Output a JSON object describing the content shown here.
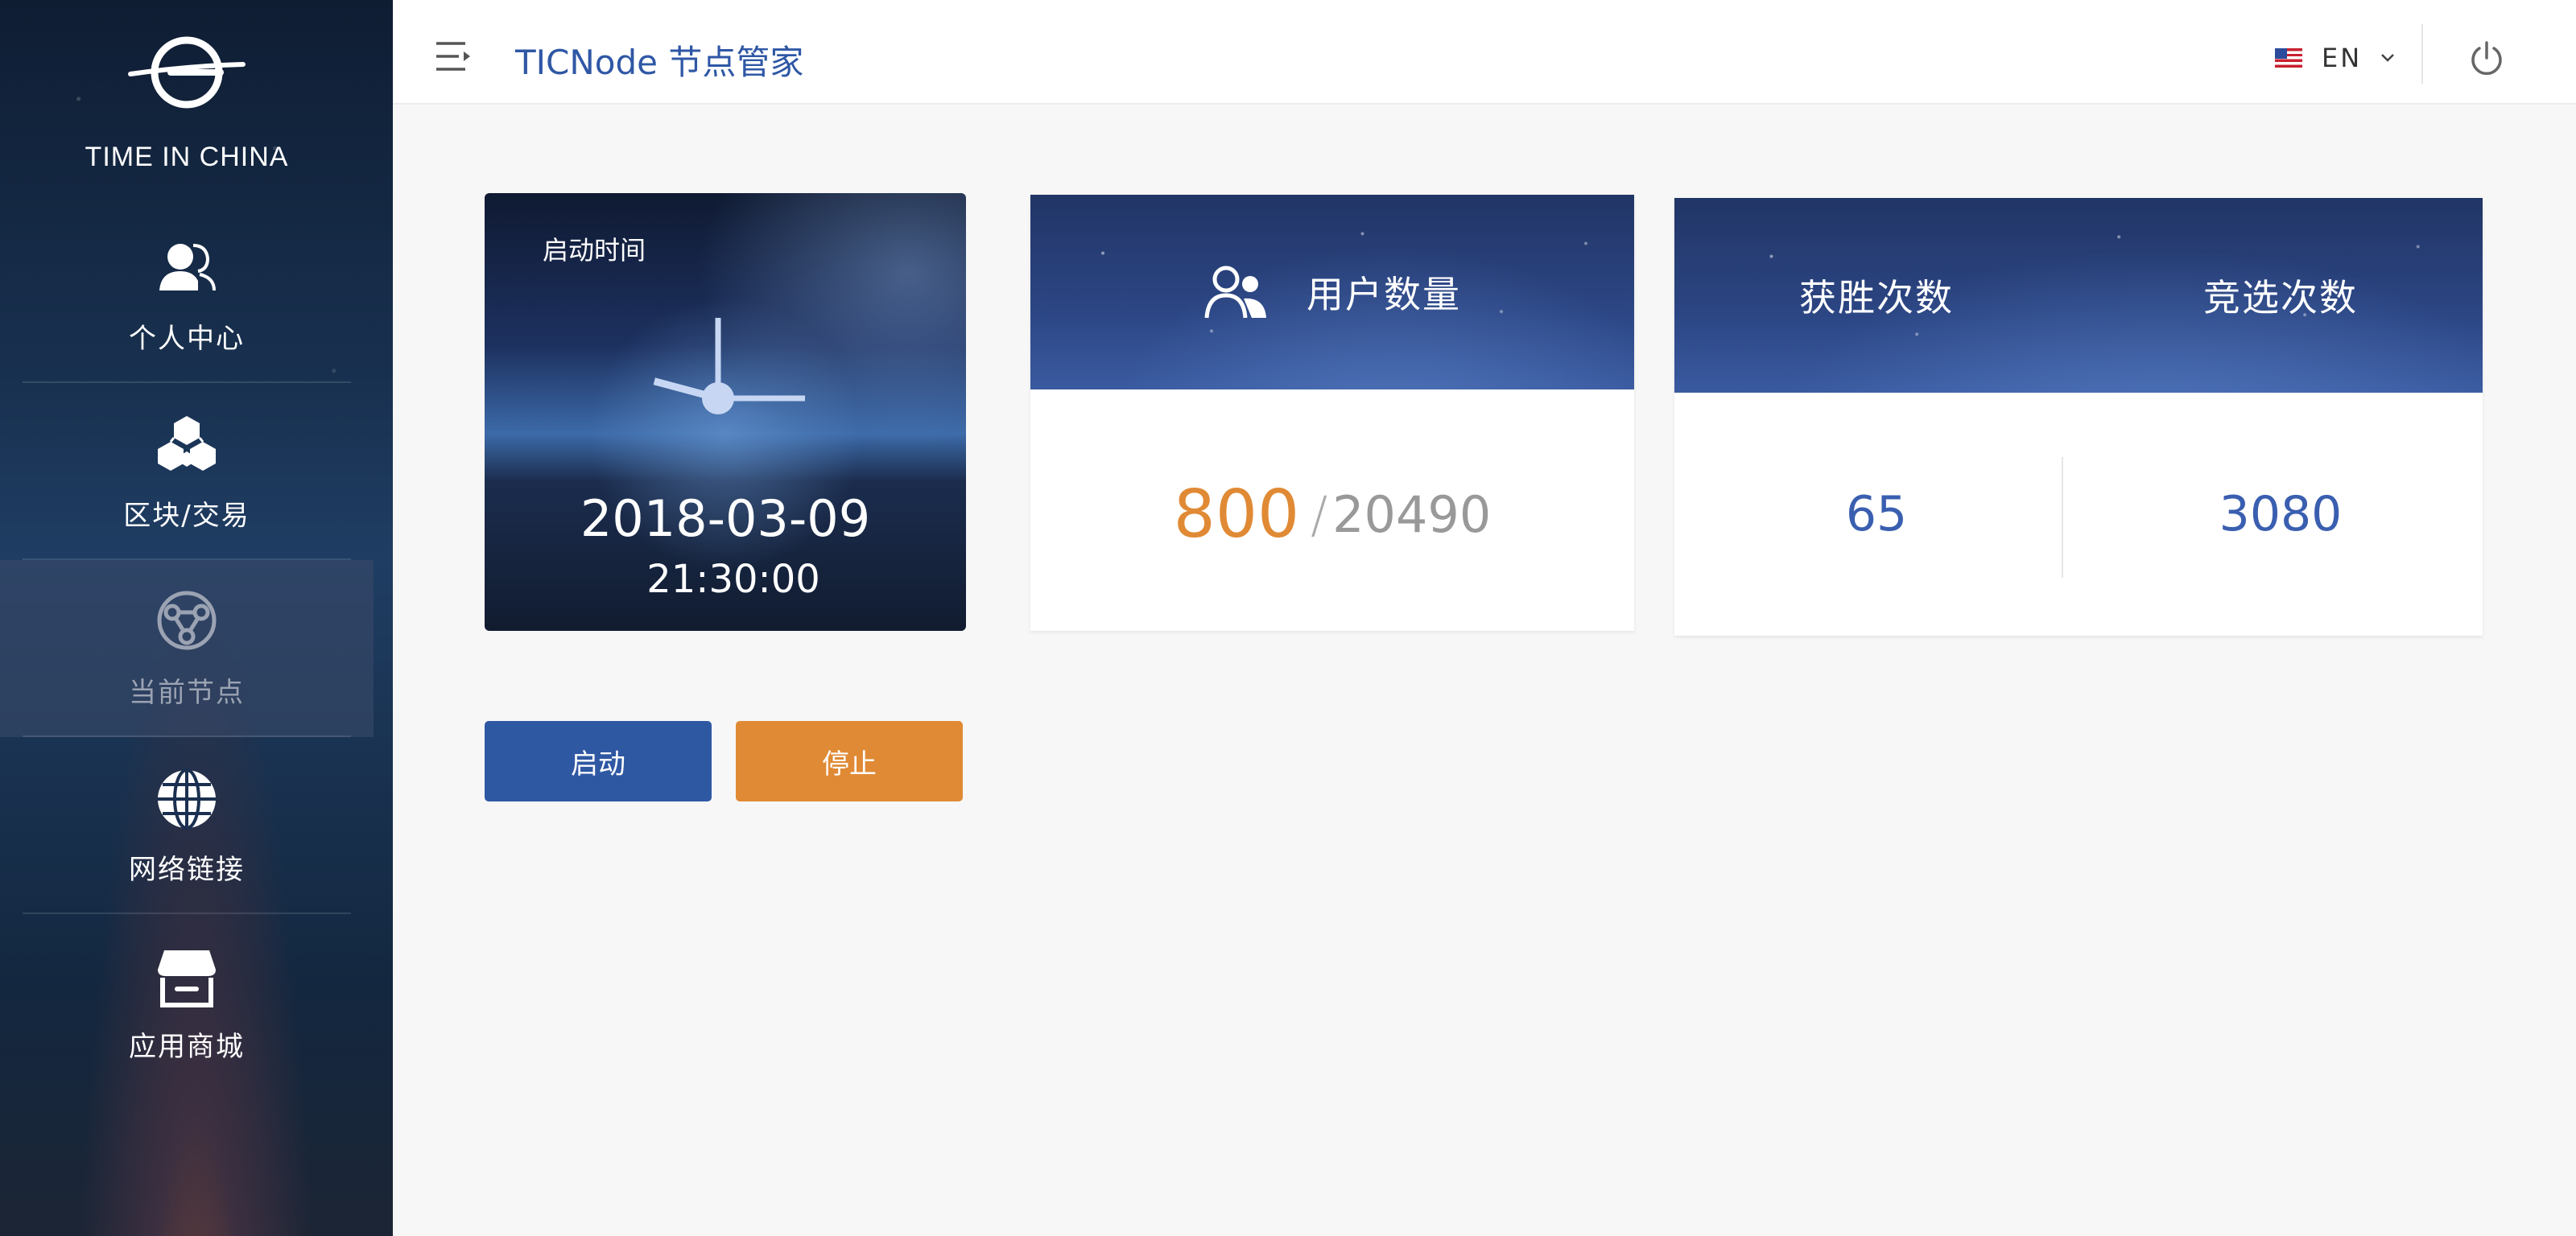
{
  "sidebar": {
    "logo_text": "TIME IN CHINA",
    "items": [
      {
        "label": "个人中心",
        "icon": "user-center-icon"
      },
      {
        "label": "区块/交易",
        "icon": "blocks-icon"
      },
      {
        "label": "当前节点",
        "icon": "node-icon",
        "active": true
      },
      {
        "label": "网络链接",
        "icon": "globe-icon"
      },
      {
        "label": "应用商城",
        "icon": "store-icon"
      }
    ]
  },
  "header": {
    "title": "TICNode 节点管家",
    "language": "EN",
    "colors": {
      "title": "#2f57a5"
    }
  },
  "clock_card": {
    "label": "启动时间",
    "date": "2018-03-09",
    "time": "21:30:00"
  },
  "users_card": {
    "title": "用户数量",
    "current": "800",
    "separator": "/",
    "total": "20490"
  },
  "wins_card": {
    "wins_label": "获胜次数",
    "elections_label": "竞选次数",
    "wins_value": "65",
    "elections_value": "3080"
  },
  "actions": {
    "start_label": "启动",
    "stop_label": "停止",
    "colors": {
      "start": "#2f58a3",
      "stop": "#e08a35"
    }
  }
}
